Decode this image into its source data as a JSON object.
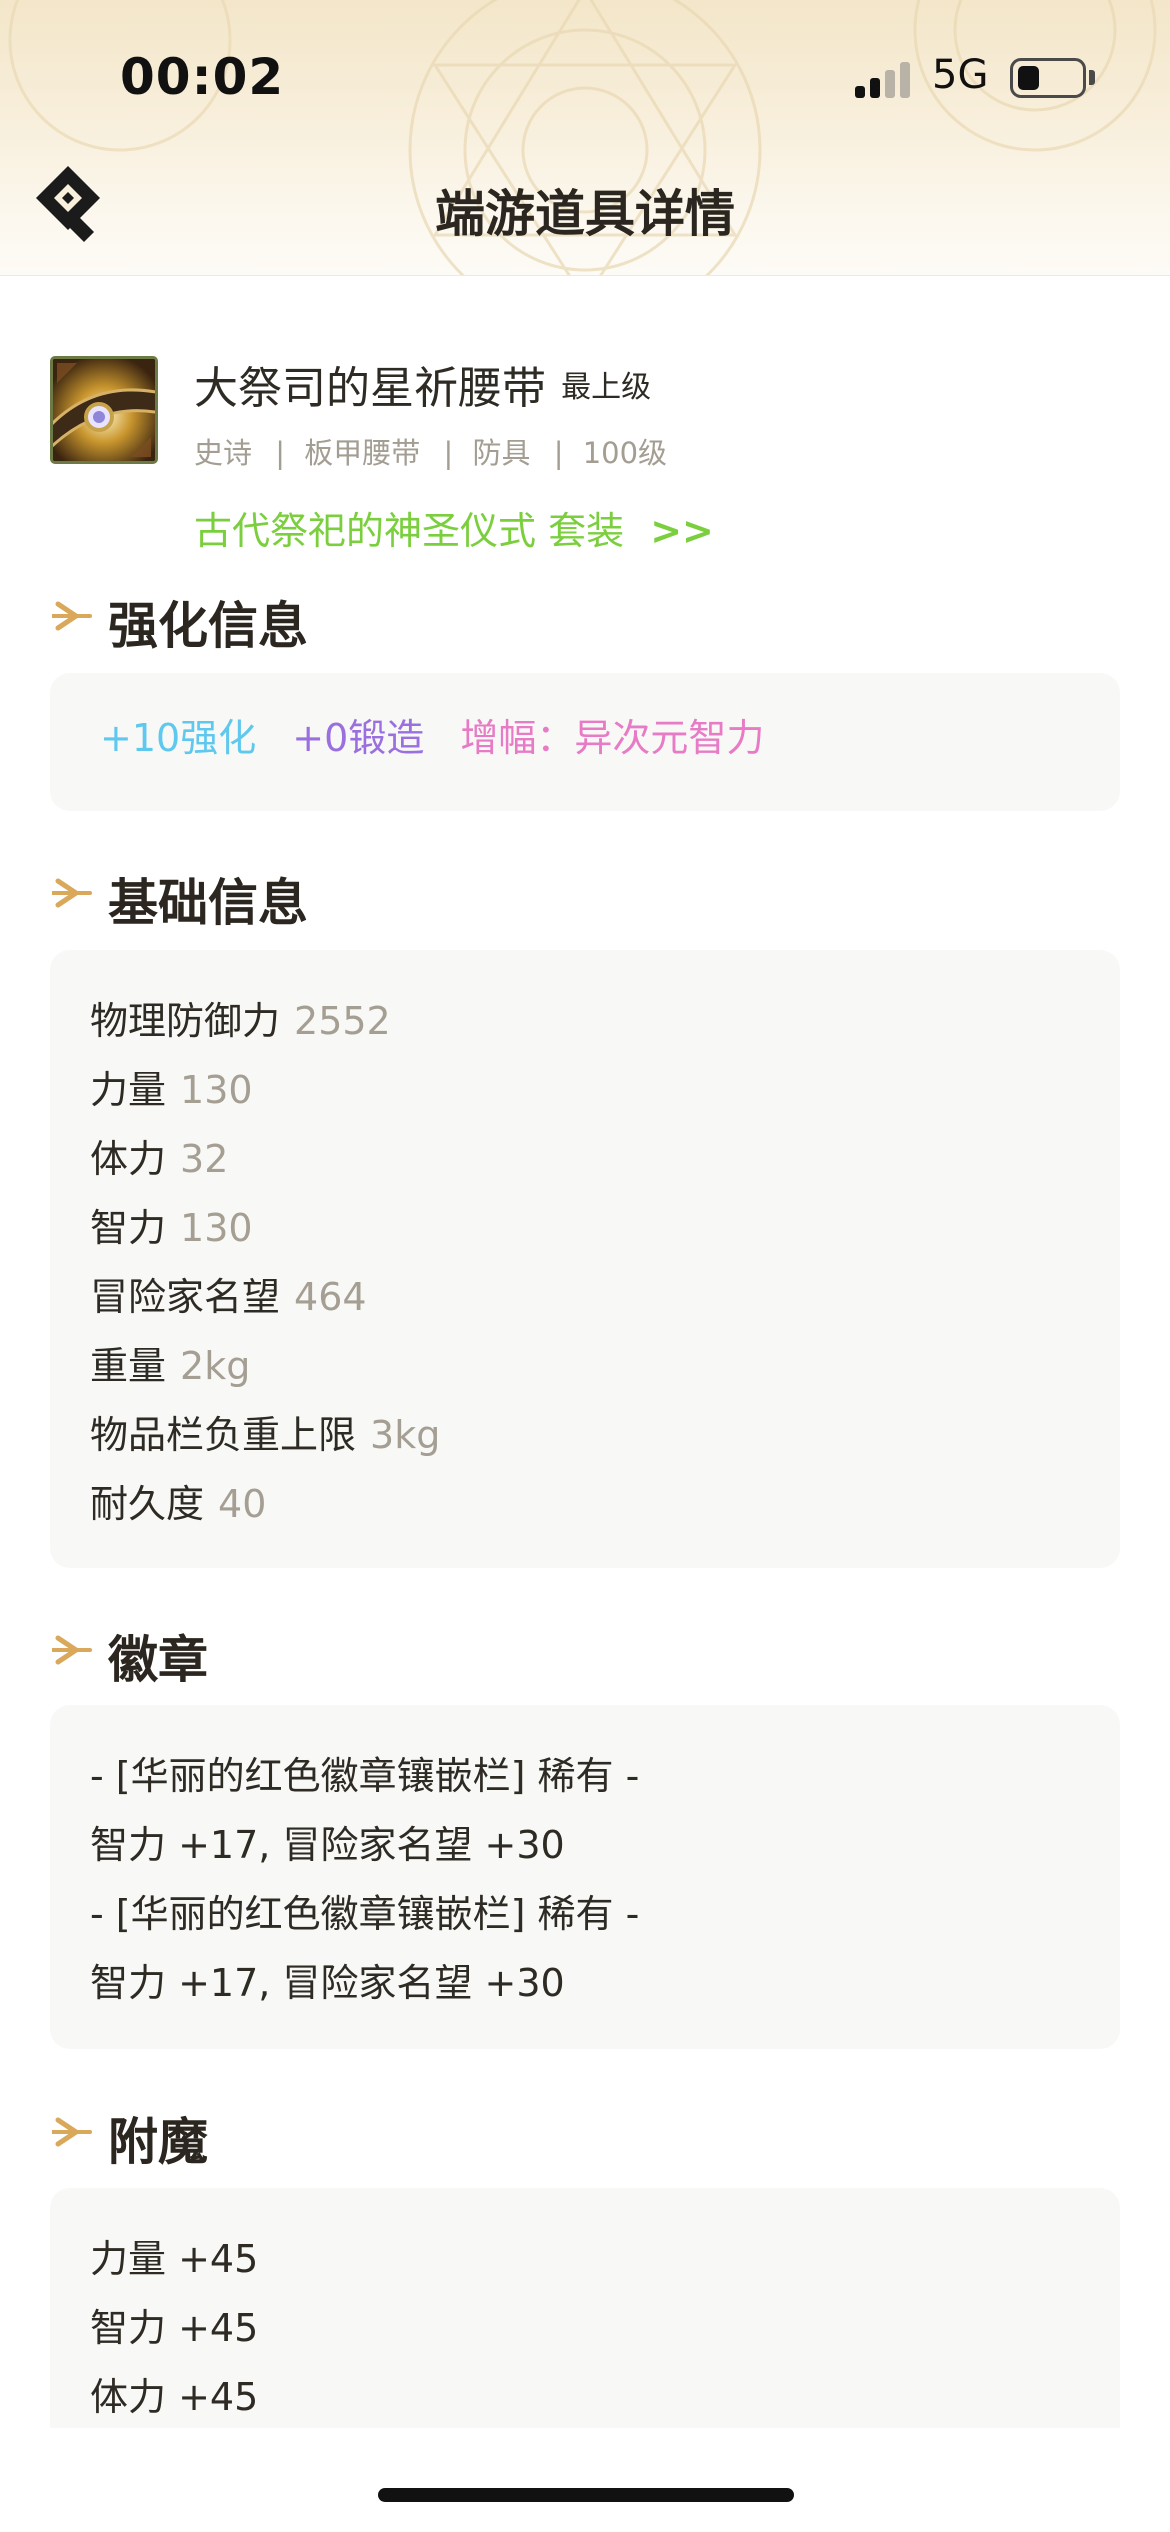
{
  "status_bar": {
    "time": "00:02",
    "network": "5G",
    "signal_bars": 2,
    "battery_level": 0.35
  },
  "header": {
    "title": "端游道具详情",
    "back_icon": "diamond-back-icon"
  },
  "item": {
    "name": "大祭司的星祈腰带",
    "grade": "最上级",
    "rarity": "史诗",
    "type": "板甲腰带",
    "category": "防具",
    "level": "100级",
    "meta_separator": "|",
    "set_name": "古代祭祀的神圣仪式 套装",
    "set_arrow": ">>",
    "icon": "belt-item-icon"
  },
  "sections": {
    "enhance": {
      "title": "强化信息",
      "reinforce": "+10强化",
      "forge": "+0锻造",
      "amplify": "增幅：异次元智力"
    },
    "basic": {
      "title": "基础信息",
      "stats": [
        {
          "label": "物理防御力",
          "value": "2552"
        },
        {
          "label": "力量",
          "value": "130"
        },
        {
          "label": "体力",
          "value": "32"
        },
        {
          "label": "智力",
          "value": "130"
        },
        {
          "label": "冒险家名望",
          "value": "464"
        },
        {
          "label": "重量",
          "value": "2kg"
        },
        {
          "label": "物品栏负重上限",
          "value": "3kg"
        },
        {
          "label": "耐久度",
          "value": "40"
        }
      ]
    },
    "emblem": {
      "title": "徽章",
      "lines": [
        "- [华丽的红色徽章镶嵌栏] 稀有 -",
        "智力 +17, 冒险家名望 +30",
        "- [华丽的红色徽章镶嵌栏] 稀有 -",
        "智力 +17, 冒险家名望 +30"
      ]
    },
    "enchant": {
      "title": "附魔",
      "lines": [
        "力量 +45",
        "智力 +45",
        "体力 +45"
      ]
    }
  },
  "colors": {
    "reinforce": "#5ec8ef",
    "forge": "#9a6fe0",
    "amplify": "#e77bc6",
    "set_link": "#7bcf3e",
    "stat_value": "#a59f93",
    "section_arrow": "#d9a85a"
  }
}
